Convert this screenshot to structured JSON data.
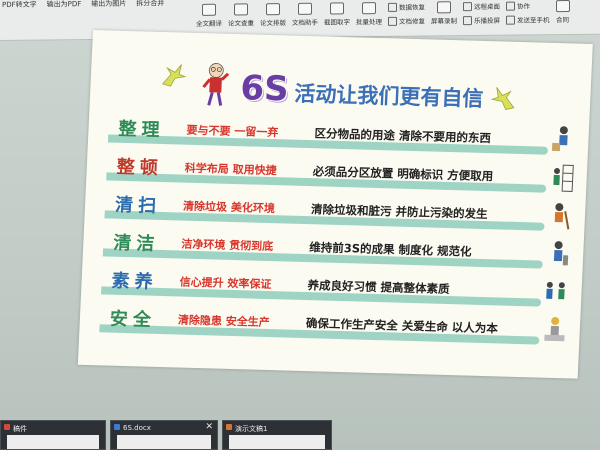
{
  "toolbar": {
    "top_items": [
      "PDF转文字",
      "输出为PDF",
      "输出为图片",
      "拆分合并"
    ],
    "buttons": [
      {
        "label": "全文翻译",
        "icon": "translate-icon"
      },
      {
        "label": "论文查重",
        "icon": "check-icon"
      },
      {
        "label": "论文排版",
        "icon": "layout-icon"
      },
      {
        "label": "文档助手",
        "icon": "assistant-icon"
      },
      {
        "label": "截图取字",
        "icon": "screenshot-icon"
      },
      {
        "label": "批量处理",
        "icon": "batch-icon"
      }
    ],
    "side_items": [
      "数据恢复",
      "文档修复"
    ],
    "right_items": [
      "屏幕录制",
      "远程桌面",
      "乐播投屏",
      "协作",
      "发送至手机",
      "合同"
    ]
  },
  "slide": {
    "title_6s": "6S",
    "title_rest": "活动让我们更有自信",
    "rows": [
      {
        "head": "整理",
        "head_color": "#2e8b57",
        "key": "要与不要  一留一弃",
        "desc": "区分物品的用途  清除不要用的东西"
      },
      {
        "head": "整顿",
        "head_color": "#c0392b",
        "key": "科学布局  取用快捷",
        "desc": "必须品分区放置  明确标识 方便取用"
      },
      {
        "head": "清扫",
        "head_color": "#2b6cb0",
        "key": "清除垃圾  美化环境",
        "desc": "清除垃圾和脏污  并防止污染的发生"
      },
      {
        "head": "清洁",
        "head_color": "#2e8b57",
        "key": "洁净环境  贯彻到底",
        "desc": "维持前3S的成果  制度化 规范化"
      },
      {
        "head": "素养",
        "head_color": "#2b6cb0",
        "key": "信心提升  效率保证",
        "desc": "养成良好习惯  提高整体素质"
      },
      {
        "head": "安全",
        "head_color": "#2e8b57",
        "key": "清除隐患  安全生产",
        "desc": "确保工作生产安全  关爱生命  以人为本"
      }
    ]
  },
  "taskbar": {
    "windows": [
      {
        "title": "稿件",
        "icon_color": "#d04a3a"
      },
      {
        "title": "6S.docx",
        "icon_color": "#3a7bd5"
      },
      {
        "title": "演示文稿1",
        "icon_color": "#d9742b"
      }
    ]
  }
}
